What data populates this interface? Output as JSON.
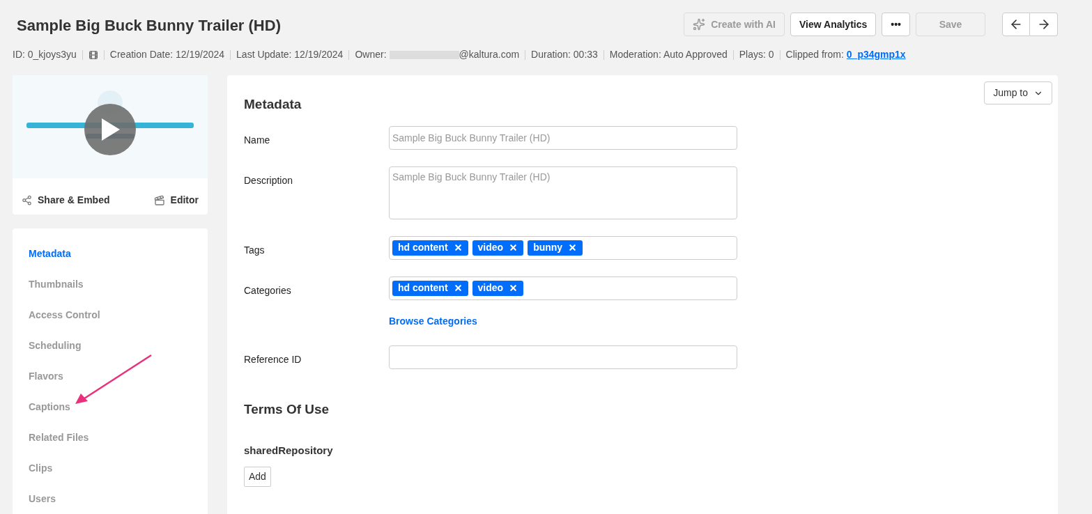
{
  "header": {
    "title": "Sample Big Buck Bunny Trailer (HD)",
    "actions": [
      {
        "label": "Create with AI",
        "kind": "ai",
        "disabled": true
      },
      {
        "label": "View Analytics",
        "kind": "text",
        "disabled": false
      },
      {
        "label": "•••",
        "kind": "text",
        "disabled": false
      },
      {
        "label": "Save",
        "kind": "save",
        "disabled": true
      }
    ]
  },
  "meta": [
    {
      "kind": "text",
      "text": "ID: 0_kjoys3yu"
    },
    {
      "kind": "film"
    },
    {
      "kind": "text",
      "text": "Creation Date: 12/19/2024"
    },
    {
      "kind": "text",
      "text": "Last Update: 12/19/2024"
    },
    {
      "kind": "owner",
      "label": "Owner:",
      "text": "@kaltura.com"
    },
    {
      "kind": "text",
      "text": "Duration: 00:33"
    },
    {
      "kind": "text",
      "text": "Moderation: Auto Approved"
    },
    {
      "kind": "text",
      "text": "Plays: 0"
    },
    {
      "kind": "link",
      "label": "Clipped from:",
      "text": "0_p34gmp1x"
    }
  ],
  "preview": {
    "share": "Share & Embed",
    "editor": "Editor"
  },
  "sidebar": {
    "items": [
      {
        "label": "Metadata",
        "selected": true
      },
      {
        "label": "Thumbnails",
        "selected": false
      },
      {
        "label": "Access Control",
        "selected": false
      },
      {
        "label": "Scheduling",
        "selected": false
      },
      {
        "label": "Flavors",
        "selected": false
      },
      {
        "label": "Captions",
        "selected": false
      },
      {
        "label": "Related Files",
        "selected": false
      },
      {
        "label": "Clips",
        "selected": false
      },
      {
        "label": "Users",
        "selected": false
      }
    ]
  },
  "main": {
    "jump_to": "Jump to",
    "section_title": "Metadata",
    "fields": [
      {
        "kind": "input",
        "label": "Name",
        "placeholder": "Sample Big Buck Bunny Trailer (HD)"
      },
      {
        "kind": "textarea",
        "label": "Description",
        "placeholder": "Sample Big Buck Bunny Trailer (HD)"
      },
      {
        "kind": "tags",
        "label": "Tags",
        "tags": [
          "hd content",
          "video",
          "bunny"
        ]
      },
      {
        "kind": "tags",
        "label": "Categories",
        "tags": [
          "hd content",
          "video"
        ],
        "link": "Browse Categories"
      },
      {
        "kind": "input",
        "label": "Reference ID"
      }
    ],
    "terms_title": "Terms Of Use",
    "shared_label": "sharedRepository",
    "add_button": "Add"
  }
}
